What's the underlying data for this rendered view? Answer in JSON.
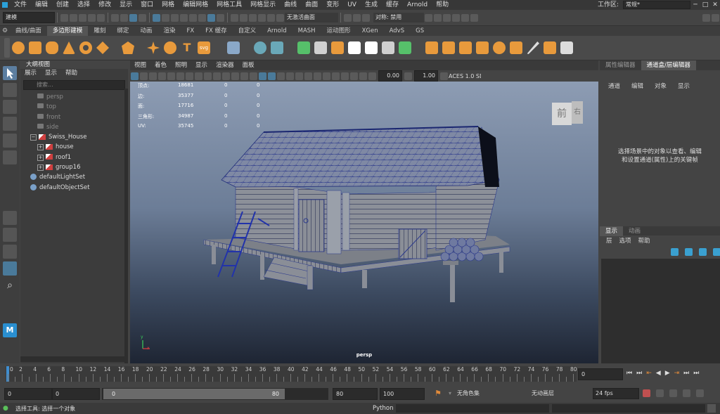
{
  "menubar": {
    "items": [
      "文件",
      "编辑",
      "创建",
      "选择",
      "修改",
      "显示",
      "窗口",
      "网格",
      "编辑网格",
      "网格工具",
      "网格显示",
      "曲线",
      "曲面",
      "变形",
      "UV",
      "生成",
      "缓存",
      "Arnold",
      "帮助"
    ],
    "workspace_label": "工作区:",
    "workspace_value": "常规*"
  },
  "statusline": {
    "mode_value": "建模",
    "live_surface": "无激活曲面",
    "symmetry": "对称: 禁用"
  },
  "shelf": {
    "tabs": [
      "曲线/曲面",
      "多边形建模",
      "雕刻",
      "绑定",
      "动画",
      "渲染",
      "FX",
      "FX 缓存",
      "自定义",
      "Arnold",
      "MASH",
      "运动图形",
      "XGen",
      "AdvS",
      "GS"
    ],
    "active_tab": "多边形建模",
    "text_icon": "T",
    "svg_icon": "svg"
  },
  "outliner": {
    "title": "大纲视图",
    "menus": [
      "展示",
      "显示",
      "帮助"
    ],
    "search_placeholder": "搜索...",
    "items": [
      {
        "label": "persp",
        "kind": "camera",
        "indent": 1
      },
      {
        "label": "top",
        "kind": "camera",
        "indent": 1
      },
      {
        "label": "front",
        "kind": "camera",
        "indent": 1
      },
      {
        "label": "side",
        "kind": "camera",
        "indent": 1
      },
      {
        "label": "Swiss_House",
        "kind": "group-open",
        "indent": 0
      },
      {
        "label": "house",
        "kind": "group",
        "indent": 1
      },
      {
        "label": "roof1",
        "kind": "group",
        "indent": 1
      },
      {
        "label": "group16",
        "kind": "group",
        "indent": 1
      },
      {
        "label": "defaultLightSet",
        "kind": "set",
        "indent": 0
      },
      {
        "label": "defaultObjectSet",
        "kind": "set",
        "indent": 0
      }
    ]
  },
  "viewport": {
    "menus": [
      "视图",
      "着色",
      "照明",
      "显示",
      "渲染器",
      "面板"
    ],
    "exposure": "0.00",
    "gamma": "1.00",
    "color_space": "ACES 1.0 SDR-video (sRGB)",
    "camera_label": "persp",
    "viewcube_front": "前",
    "viewcube_right": "右",
    "hud": [
      {
        "label": "顶点:",
        "a": "18681",
        "b": "0",
        "c": "0"
      },
      {
        "label": "边:",
        "a": "35377",
        "b": "0",
        "c": "0"
      },
      {
        "label": "面:",
        "a": "17716",
        "b": "0",
        "c": "0"
      },
      {
        "label": "三角形:",
        "a": "34987",
        "b": "0",
        "c": "0"
      },
      {
        "label": "UV:",
        "a": "35745",
        "b": "0",
        "c": "0"
      }
    ],
    "axis_y": "y",
    "axis_x": "x"
  },
  "rpanel": {
    "tabs": [
      "属性编辑器",
      "通道盒/层编辑器"
    ],
    "active_tab": "通道盒/层编辑器",
    "menus": [
      "通道",
      "编辑",
      "对象",
      "显示"
    ],
    "empty_msg_1": "选择场景中的对象以查看、编辑",
    "empty_msg_2": "和设置通道(属性)上的关键帧",
    "layer_tabs": [
      "显示",
      "动画"
    ],
    "layer_menus": [
      "层",
      "选项",
      "帮助"
    ]
  },
  "timeslider": {
    "ticks": [
      "2",
      "4",
      "6",
      "8",
      "10",
      "12",
      "14",
      "16",
      "18",
      "20",
      "22",
      "24",
      "26",
      "28",
      "30",
      "32",
      "34",
      "36",
      "38",
      "40",
      "42",
      "44",
      "46",
      "48",
      "50",
      "52",
      "54",
      "56",
      "58",
      "60",
      "62",
      "64",
      "66",
      "68",
      "70",
      "72",
      "74",
      "76",
      "78",
      "80"
    ],
    "first_tick": "0",
    "current_frame": "0"
  },
  "range": {
    "start": "0",
    "inner_start": "0",
    "slider_start": "0",
    "slider_end": "80",
    "inner_end": "80",
    "end": "100",
    "char_set": "无角色集",
    "anim_layer": "无动画层",
    "fps": "24 fps"
  },
  "cmdline": {
    "help": "选择工具: 选择一个对象",
    "lang": "Python"
  }
}
